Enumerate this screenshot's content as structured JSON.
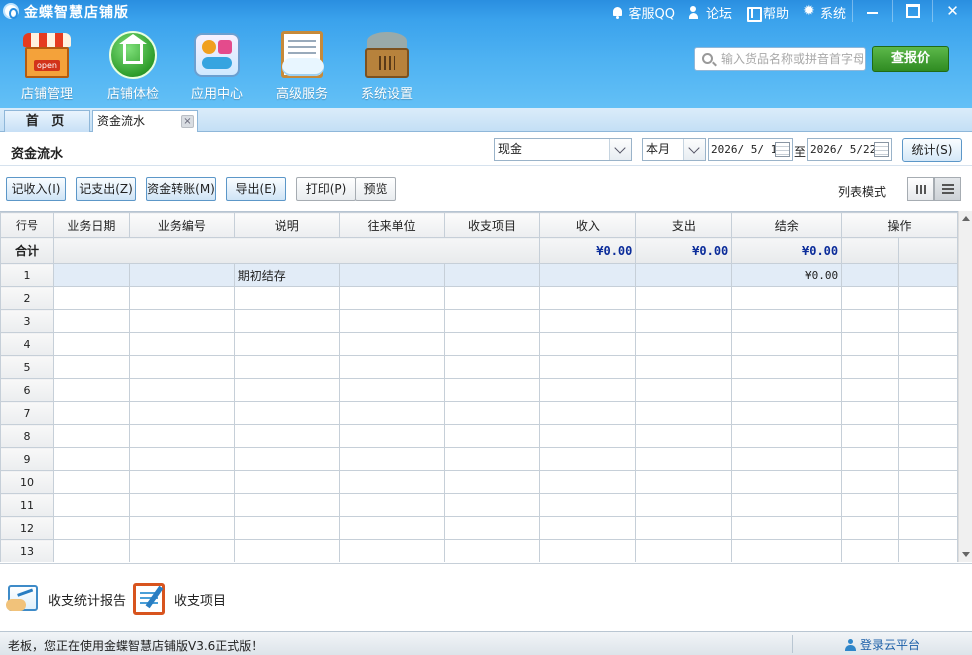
{
  "app": {
    "title": "金蝶智慧店铺版",
    "nav": [
      "客服QQ",
      "论坛",
      "帮助",
      "系统"
    ]
  },
  "modules": [
    {
      "label": "店铺管理",
      "icon": "shop-icon"
    },
    {
      "label": "店铺体检",
      "icon": "home-check-icon"
    },
    {
      "label": "应用中心",
      "icon": "app-center-icon"
    },
    {
      "label": "高级服务",
      "icon": "clipboard-cloud-icon"
    },
    {
      "label": "系统设置",
      "icon": "toolbox-icon"
    }
  ],
  "search": {
    "placeholder": "输入货品名称或拼音首字母",
    "button": "查报价"
  },
  "tabs": {
    "home": "首 页",
    "active": "资金流水",
    "close": "×"
  },
  "filter": {
    "title": "资金流水",
    "account": "现金",
    "period": "本月",
    "date_from": "2026/ 5/ 1",
    "to": "至",
    "date_to": "2026/ 5/22",
    "stat_button": "统计(S)"
  },
  "toolbar": {
    "income": "记收入(I)",
    "expense": "记支出(Z)",
    "transfer": "资金转账(M)",
    "export": "导出(E)",
    "print": "打印(P)",
    "preview": "预览",
    "list_mode": "列表模式"
  },
  "table": {
    "headers": [
      "行号",
      "业务日期",
      "业务编号",
      "说明",
      "往来单位",
      "收支项目",
      "收入",
      "支出",
      "结余",
      "操作"
    ],
    "summary": {
      "label": "合计",
      "income": "¥0.00",
      "expense": "¥0.00",
      "balance": "¥0.00"
    },
    "opening": {
      "row": "1",
      "desc": "期初结存",
      "balance": "¥0.00"
    },
    "empty_rows": [
      "2",
      "3",
      "4",
      "5",
      "6",
      "7",
      "8",
      "9",
      "10",
      "11",
      "12",
      "13"
    ]
  },
  "bottom": {
    "report": "收支统计报告",
    "items": "收支项目"
  },
  "status": {
    "text": "老板，您正在使用金蝶智慧店铺版V3.6正式版！",
    "login": "登录云平台"
  },
  "colors": {
    "header_blue": "#3aa2ec",
    "quote_green": "#2f8b22",
    "money_blue": "#0b2c9a"
  }
}
